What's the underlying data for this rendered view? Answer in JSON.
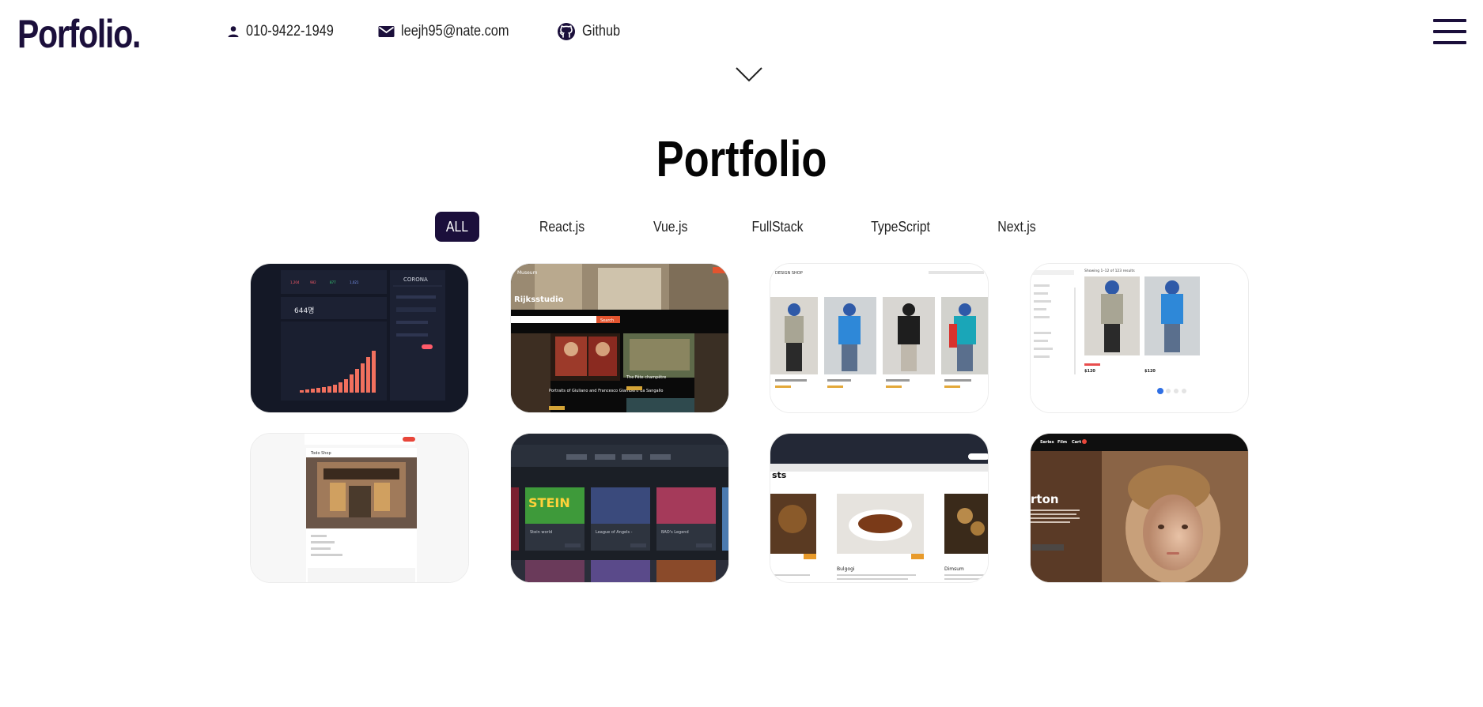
{
  "header": {
    "logo": "Porfolio.",
    "phone": "010-9422-1949",
    "email": "leejh95@nate.com",
    "github_label": "Github",
    "menu_icon": "hamburger-menu-icon",
    "scroll_icon": "chevron-down-icon"
  },
  "portfolio": {
    "title": "Portfolio",
    "filters": [
      {
        "label": "ALL",
        "active": true
      },
      {
        "label": "React.js",
        "active": false
      },
      {
        "label": "Vue.js",
        "active": false
      },
      {
        "label": "FullStack",
        "active": false
      },
      {
        "label": "TypeScript",
        "active": false
      },
      {
        "label": "Next.js",
        "active": false
      }
    ],
    "projects": [
      {
        "thumb_text": "CORONA",
        "stat": "644명"
      },
      {
        "thumb_text": "Rijksstudio",
        "brand": "Museum",
        "search": "Search",
        "caption_left": "Portraits of Giuliano and Francesco Giamberti da Sangallo",
        "caption_right": "The Fête champêtre"
      },
      {
        "thumb_text": "DESIGN SHOP"
      },
      {
        "thumb_text": "Showing 1–12 of 123 results",
        "price_a": "$120",
        "price_b": "$120"
      },
      {
        "thumb_text": "Todo Shop"
      },
      {
        "thumb_text": "STEIN",
        "games": [
          "Stein world",
          "League of Angels -",
          "BAO's Legend"
        ]
      },
      {
        "thumb_text": "sts",
        "dishes": [
          "Bulgogi",
          "Dimsum"
        ]
      },
      {
        "thumb_text": "rton",
        "nav": [
          "Series",
          "Film",
          "Cart"
        ]
      }
    ]
  },
  "colors": {
    "brand": "#1b0f3b",
    "text": "#222222",
    "background": "#ffffff"
  }
}
